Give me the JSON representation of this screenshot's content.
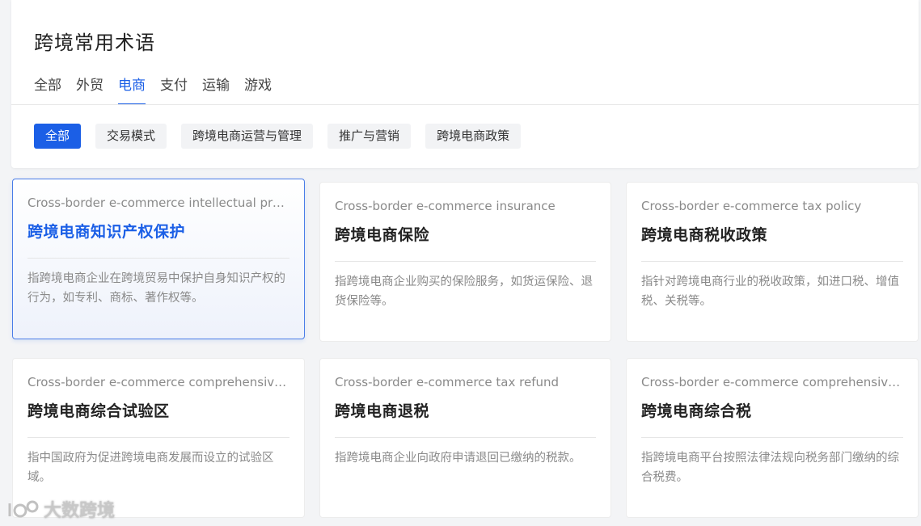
{
  "page_title": "跨境常用术语",
  "tabs": [
    {
      "label": "全部",
      "active": false
    },
    {
      "label": "外贸",
      "active": false
    },
    {
      "label": "电商",
      "active": true
    },
    {
      "label": "支付",
      "active": false
    },
    {
      "label": "运输",
      "active": false
    },
    {
      "label": "游戏",
      "active": false
    }
  ],
  "chips": [
    {
      "label": "全部",
      "active": true
    },
    {
      "label": "交易模式",
      "active": false
    },
    {
      "label": "跨境电商运营与管理",
      "active": false
    },
    {
      "label": "推广与营销",
      "active": false
    },
    {
      "label": "跨境电商政策",
      "active": false
    }
  ],
  "cards": [
    {
      "en": "Cross-border e-commerce intellectual property protection",
      "zh": "跨境电商知识产权保护",
      "desc": "指跨境电商企业在跨境贸易中保护自身知识产权的行为，如专利、商标、著作权等。"
    },
    {
      "en": "Cross-border e-commerce insurance",
      "zh": "跨境电商保险",
      "desc": "指跨境电商企业购买的保险服务，如货运保险、退货保险等。"
    },
    {
      "en": "Cross-border e-commerce tax policy",
      "zh": "跨境电商税收政策",
      "desc": "指针对跨境电商行业的税收政策，如进口税、增值税、关税等。"
    },
    {
      "en": "Cross-border e-commerce comprehensive test zone",
      "zh": "跨境电商综合试验区",
      "desc": "指中国政府为促进跨境电商发展而设立的试验区域。"
    },
    {
      "en": "Cross-border e-commerce tax refund",
      "zh": "跨境电商退税",
      "desc": "指跨境电商企业向政府申请退回已缴纳的税款。"
    },
    {
      "en": "Cross-border e-commerce comprehensive tax",
      "zh": "跨境电商综合税",
      "desc": "指跨境电商平台按照法律法规向税务部门缴纳的综合税费。"
    }
  ],
  "watermark": "大数跨境",
  "colors": {
    "accent": "#1b5fe6",
    "muted": "#8a8a8a"
  }
}
